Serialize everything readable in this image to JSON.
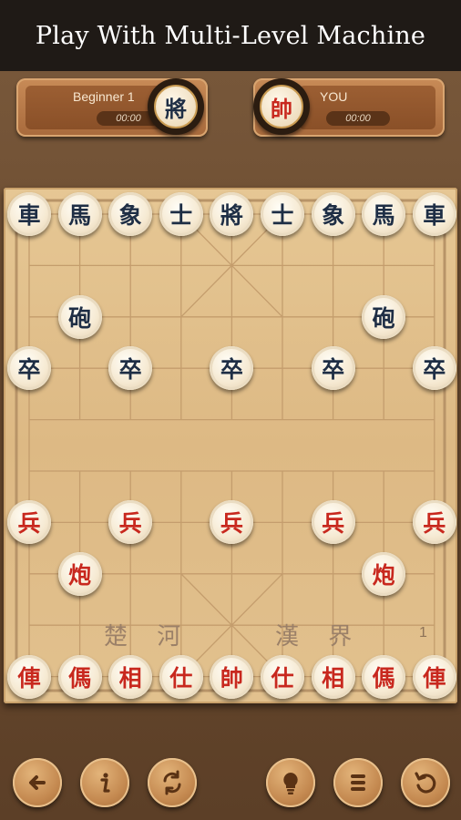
{
  "header": {
    "title": "Play With Multi-Level Machine"
  },
  "players": {
    "ai": {
      "name": "Beginner 1",
      "timer": "00:00",
      "avatar_char": "將"
    },
    "you": {
      "name": "YOU",
      "timer": "00:00",
      "avatar_char": "帥"
    }
  },
  "board": {
    "river_left": "楚 河",
    "river_right": "漢 界",
    "move_count": "1",
    "pieces": [
      {
        "char": "車",
        "side": "black",
        "col": 0,
        "row": 0
      },
      {
        "char": "馬",
        "side": "black",
        "col": 1,
        "row": 0
      },
      {
        "char": "象",
        "side": "black",
        "col": 2,
        "row": 0
      },
      {
        "char": "士",
        "side": "black",
        "col": 3,
        "row": 0
      },
      {
        "char": "將",
        "side": "black",
        "col": 4,
        "row": 0
      },
      {
        "char": "士",
        "side": "black",
        "col": 5,
        "row": 0
      },
      {
        "char": "象",
        "side": "black",
        "col": 6,
        "row": 0
      },
      {
        "char": "馬",
        "side": "black",
        "col": 7,
        "row": 0
      },
      {
        "char": "車",
        "side": "black",
        "col": 8,
        "row": 0
      },
      {
        "char": "砲",
        "side": "black",
        "col": 1,
        "row": 2
      },
      {
        "char": "砲",
        "side": "black",
        "col": 7,
        "row": 2
      },
      {
        "char": "卒",
        "side": "black",
        "col": 0,
        "row": 3
      },
      {
        "char": "卒",
        "side": "black",
        "col": 2,
        "row": 3
      },
      {
        "char": "卒",
        "side": "black",
        "col": 4,
        "row": 3
      },
      {
        "char": "卒",
        "side": "black",
        "col": 6,
        "row": 3
      },
      {
        "char": "卒",
        "side": "black",
        "col": 8,
        "row": 3
      },
      {
        "char": "兵",
        "side": "red",
        "col": 0,
        "row": 6
      },
      {
        "char": "兵",
        "side": "red",
        "col": 2,
        "row": 6
      },
      {
        "char": "兵",
        "side": "red",
        "col": 4,
        "row": 6
      },
      {
        "char": "兵",
        "side": "red",
        "col": 6,
        "row": 6
      },
      {
        "char": "兵",
        "side": "red",
        "col": 8,
        "row": 6
      },
      {
        "char": "炮",
        "side": "red",
        "col": 1,
        "row": 7
      },
      {
        "char": "炮",
        "side": "red",
        "col": 7,
        "row": 7
      },
      {
        "char": "俥",
        "side": "red",
        "col": 0,
        "row": 9
      },
      {
        "char": "傌",
        "side": "red",
        "col": 1,
        "row": 9
      },
      {
        "char": "相",
        "side": "red",
        "col": 2,
        "row": 9
      },
      {
        "char": "仕",
        "side": "red",
        "col": 3,
        "row": 9
      },
      {
        "char": "帥",
        "side": "red",
        "col": 4,
        "row": 9
      },
      {
        "char": "仕",
        "side": "red",
        "col": 5,
        "row": 9
      },
      {
        "char": "相",
        "side": "red",
        "col": 6,
        "row": 9
      },
      {
        "char": "傌",
        "side": "red",
        "col": 7,
        "row": 9
      },
      {
        "char": "俥",
        "side": "red",
        "col": 8,
        "row": 9
      }
    ]
  },
  "toolbar": [
    {
      "icon": "back-arrow-icon"
    },
    {
      "icon": "info-icon"
    },
    {
      "icon": "swap-sides-icon"
    },
    {
      "icon": "lightbulb-hint-icon"
    },
    {
      "icon": "menu-list-icon"
    },
    {
      "icon": "undo-icon"
    }
  ],
  "colors": {
    "red_piece": "#c8281e",
    "black_piece": "#1e2e45",
    "board": "#e2c18e",
    "background": "#6b4b30"
  }
}
